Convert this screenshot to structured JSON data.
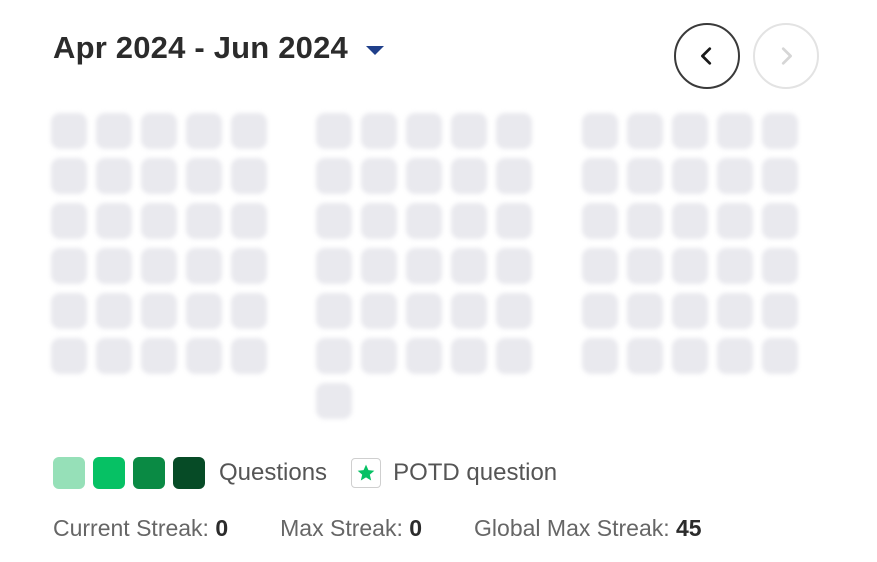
{
  "header": {
    "range_label": "Apr 2024 - Jun 2024",
    "dropdown_icon": "caret-down-icon",
    "prev_icon": "chevron-left-icon",
    "next_icon": "chevron-right-icon"
  },
  "calendar": {
    "months": [
      {
        "days": 30
      },
      {
        "days": 31
      },
      {
        "days": 30
      }
    ]
  },
  "legend": {
    "levels": [
      {
        "color": "#96e0b8"
      },
      {
        "color": "#06c164"
      },
      {
        "color": "#0a8a44"
      },
      {
        "color": "#064b26"
      }
    ],
    "questions_label": "Questions",
    "potd_icon": "star-icon",
    "potd_color": "#06c164",
    "potd_label": "POTD question"
  },
  "stats": {
    "current_label": "Current Streak:",
    "current_value": "0",
    "max_label": "Max Streak:",
    "max_value": "0",
    "global_label": "Global Max Streak:",
    "global_value": "45"
  },
  "colors": {
    "empty_cell": "#e9e9ee",
    "accent": "#1f3f8a"
  }
}
